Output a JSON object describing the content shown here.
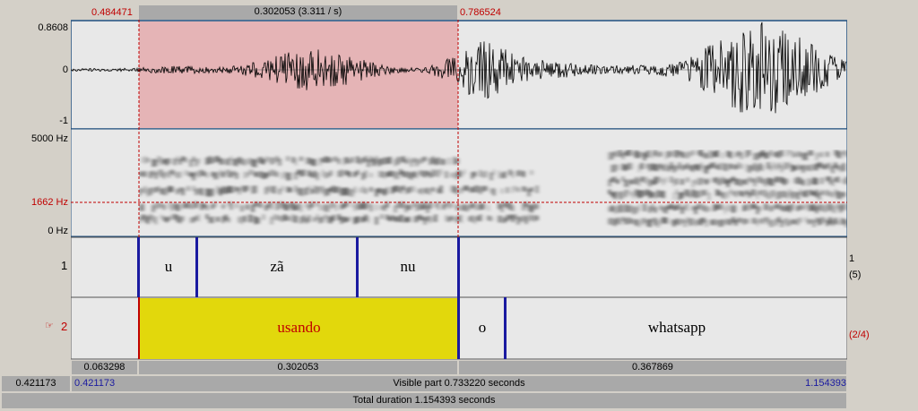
{
  "selection": {
    "start_time": "0.484471",
    "end_time": "0.786524",
    "duration_label": "0.302053 (3.311 / s)"
  },
  "waveform": {
    "y_max": "0.8608",
    "y_zero": "0",
    "y_min": "-1"
  },
  "spectrogram": {
    "y_max": "5000 Hz",
    "cursor_freq": "1662 Hz",
    "y_min": "0 Hz"
  },
  "tiers": [
    {
      "number": "1",
      "right_top": "1",
      "right_bottom": "(5)",
      "intervals": [
        "u",
        "zã",
        "nu"
      ]
    },
    {
      "number": "2",
      "right_label": "(2/4)",
      "intervals": [
        "usando",
        "o",
        "whatsapp"
      ],
      "selected_interval": "usando"
    }
  ],
  "durations": {
    "left": "0.063298",
    "middle": "0.302053",
    "right": "0.367869"
  },
  "visible": {
    "outer_start": "0.421173",
    "start": "0.421173",
    "label": "Visible part 0.733220 seconds",
    "end": "1.154393"
  },
  "total": {
    "label": "Total duration 1.154393 seconds"
  },
  "colors": {
    "selection_fill": "#e5b4b6",
    "selected_interval_fill": "#e2d80c",
    "boundary": "#1a1aa0",
    "cursor_red": "#c00000"
  }
}
